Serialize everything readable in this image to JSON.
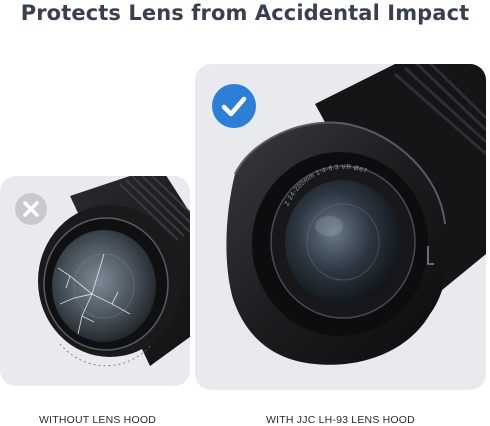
{
  "headline": "Protects Lens from Accidental Impact",
  "comparison": {
    "without": {
      "caption": "WITHOUT LENS HOOD",
      "badge_icon": "cross-icon",
      "badge_color": "#c8c9cd"
    },
    "with": {
      "caption": "WITH JJC LH-93 LENS HOOD",
      "badge_icon": "checkmark-icon",
      "badge_color": "#2d7fd6",
      "lens_ring_text": "Z 24-200mm 1:4-6.3 VR Ø67"
    }
  },
  "colors": {
    "headline": "#3a3f4f",
    "panel_background": "#e9eaee",
    "lens_body": "#1b1b1d"
  }
}
